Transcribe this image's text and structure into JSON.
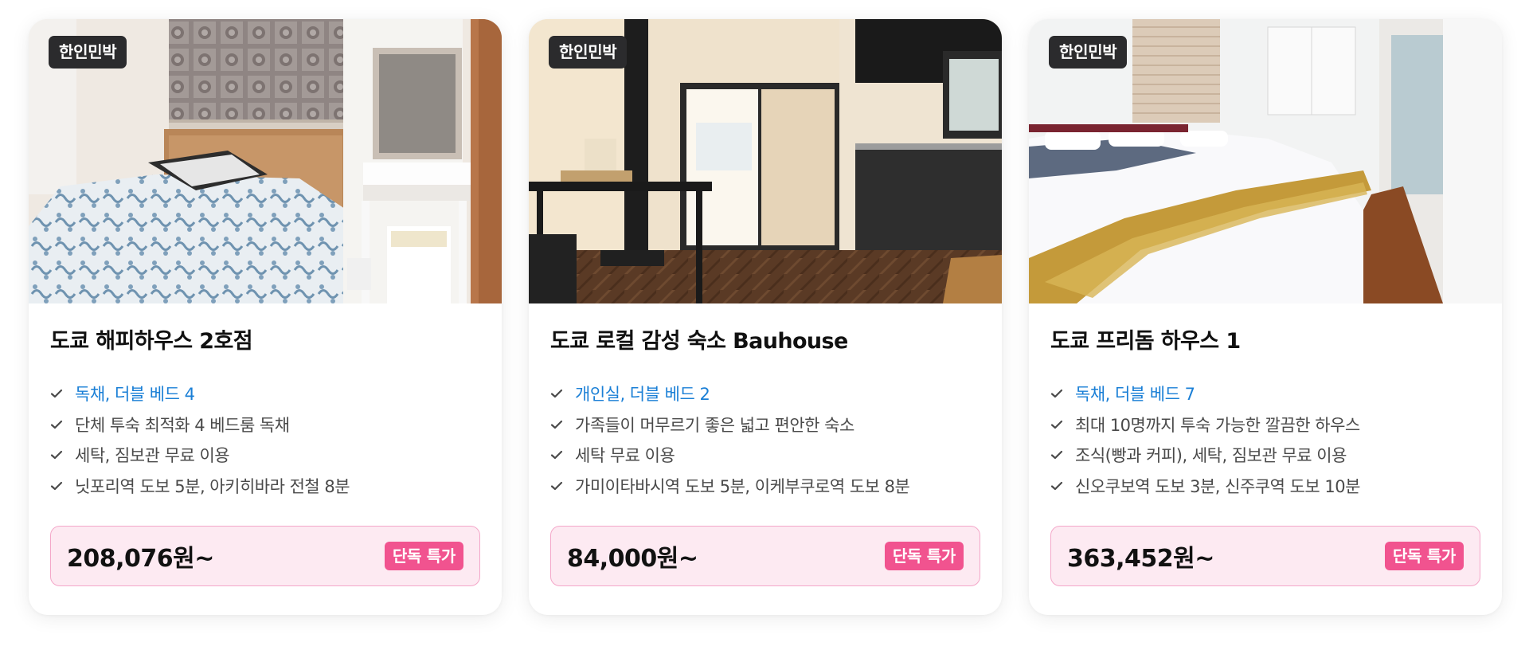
{
  "listings": [
    {
      "badge": "한인민박",
      "title": "도쿄 해피하우스 2호점",
      "features": [
        "독채, 더블 베드 4",
        "단체 투숙 최적화 4 베드룸 독채",
        "세탁, 짐보관 무료 이용",
        "닛포리역 도보 5분, 아키히바라 전철 8분"
      ],
      "price": "208,076원~",
      "deal_label": "단독 특가"
    },
    {
      "badge": "한인민박",
      "title": "도쿄 로컬 감성 숙소 Bauhouse",
      "features": [
        "개인실, 더블 베드 2",
        "가족들이 머무르기 좋은 넓고 편안한 숙소",
        "세탁 무료 이용",
        "가미이타바시역 도보 5분, 이케부쿠로역 도보 8분"
      ],
      "price": "84,000원~",
      "deal_label": "단독 특가"
    },
    {
      "badge": "한인민박",
      "title": "도쿄 프리돔 하우스 1",
      "features": [
        "독채, 더블 베드 7",
        "최대 10명까지 투숙 가능한 깔끔한 하우스",
        "조식(빵과 커피), 세탁, 짐보관 무료 이용",
        "신오쿠보역 도보 3분, 신주쿠역 도보 10분"
      ],
      "price": "363,452원~",
      "deal_label": "단독 특가"
    }
  ],
  "colors": {
    "highlight_text": "#1a7fd6",
    "badge_bg": "#2b2b2d",
    "price_box_bg": "#fdeaf2",
    "price_box_border": "#f4a7c9",
    "deal_badge_bg": "#f1538f"
  },
  "icons": {
    "feature_bullet": "check-icon"
  }
}
